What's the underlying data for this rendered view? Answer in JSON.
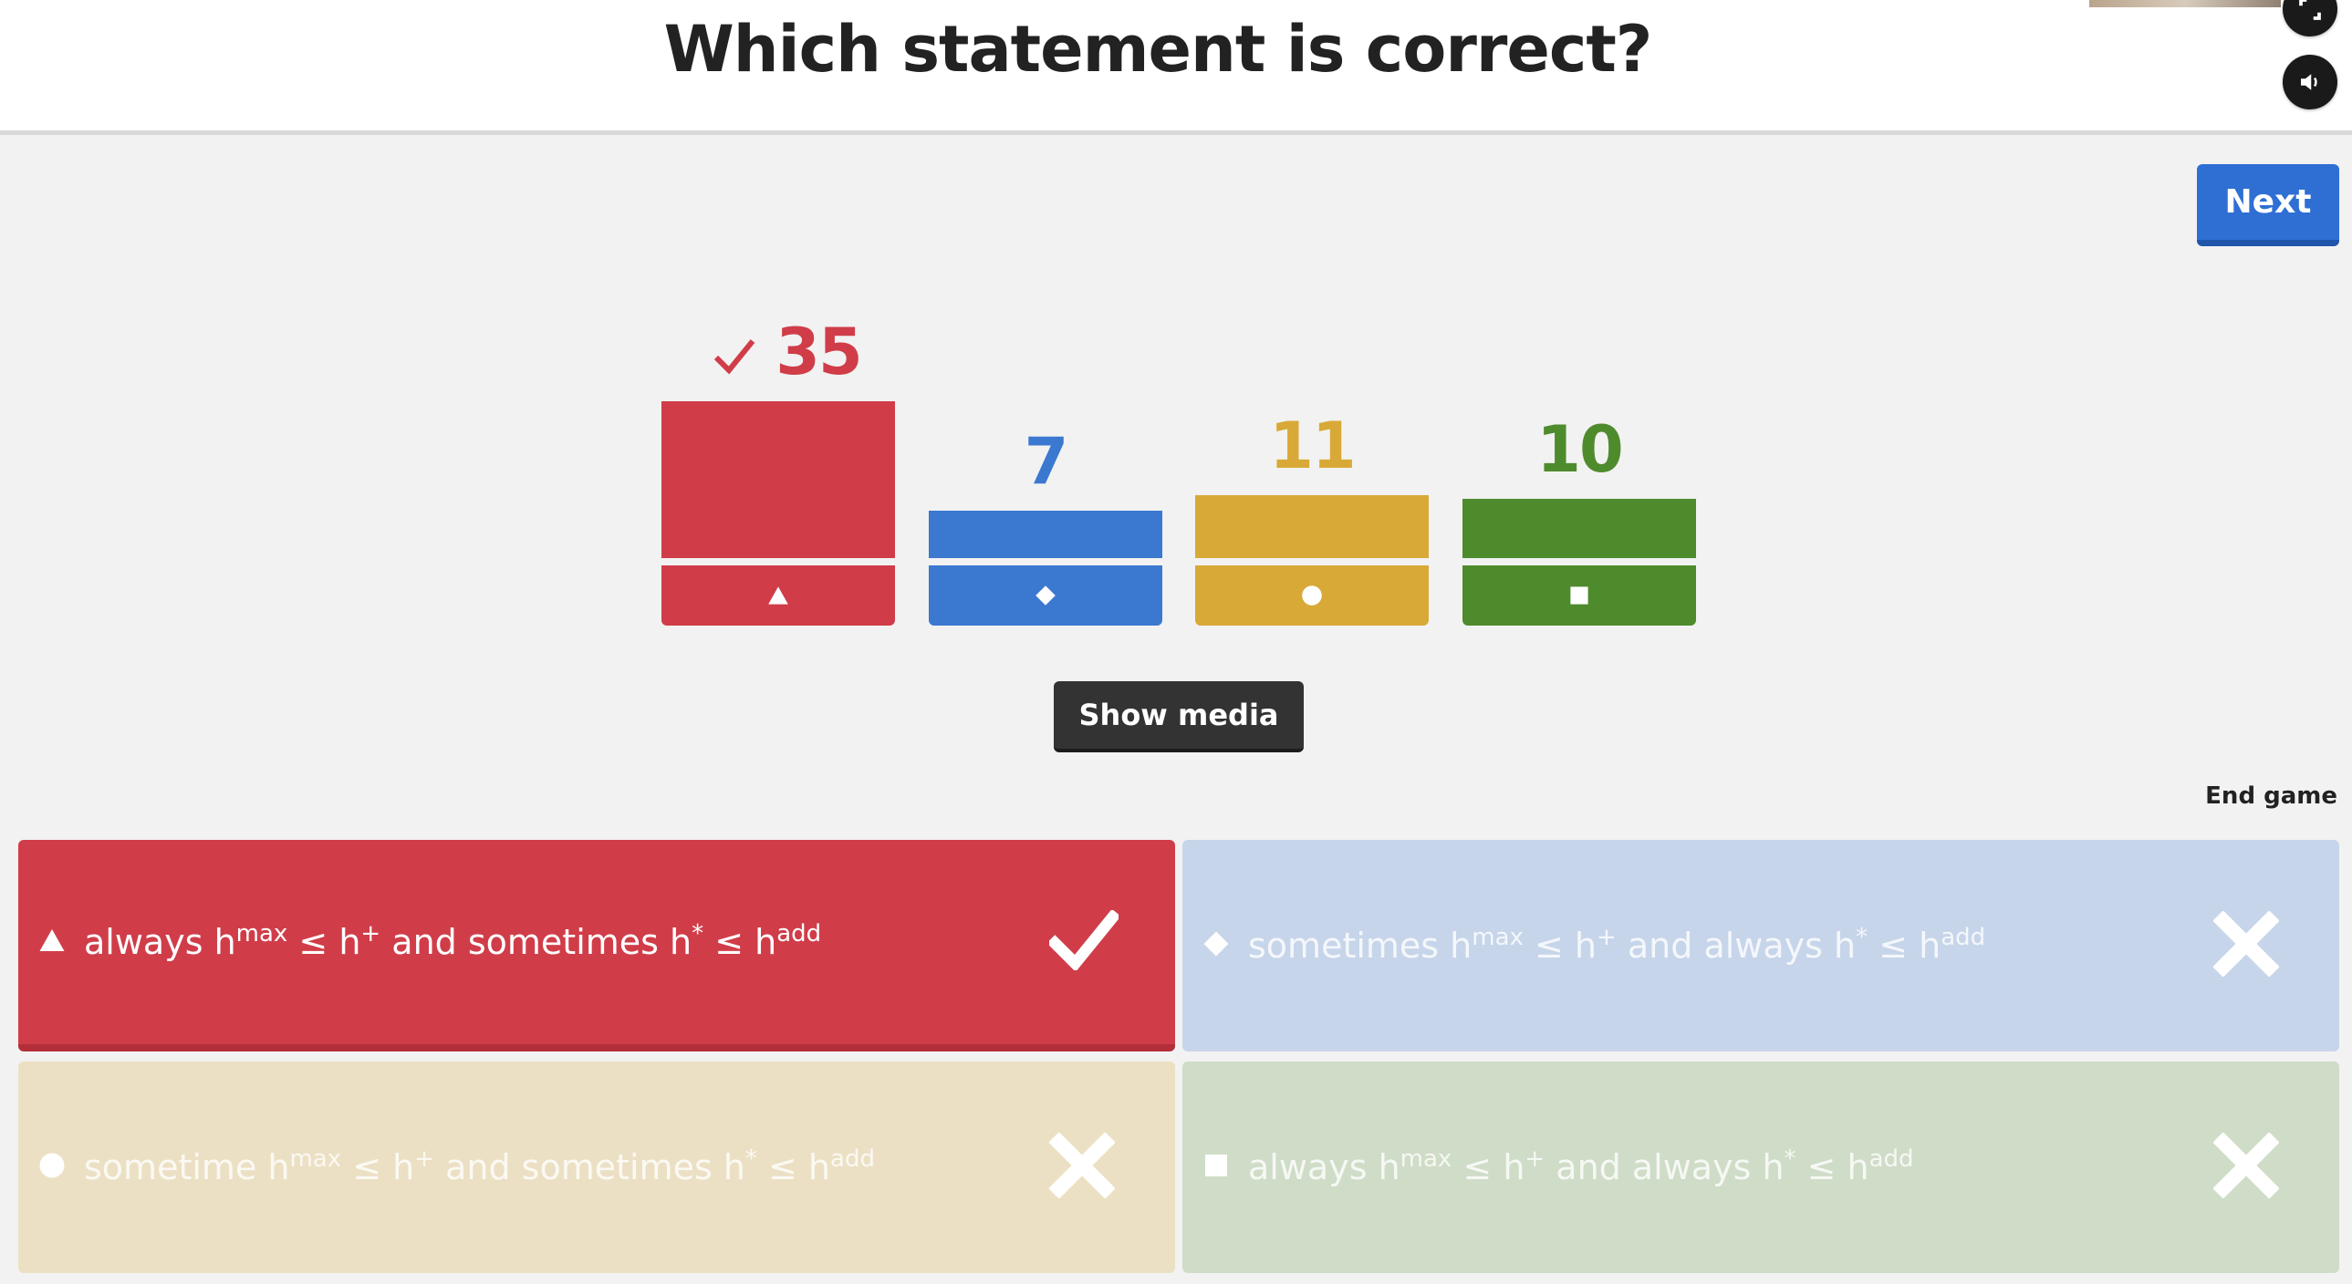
{
  "question": "Which statement is correct?",
  "controls": {
    "next_label": "Next",
    "show_media_label": "Show media",
    "end_game_label": "End game"
  },
  "colors": {
    "red": "#d03d49",
    "blue": "#3b78d0",
    "yellow": "#d8a937",
    "green": "#4e8b2d"
  },
  "chart_data": {
    "type": "bar",
    "categories": [
      "triangle",
      "diamond",
      "circle",
      "square"
    ],
    "values": [
      35,
      7,
      11,
      10
    ],
    "correct_index": 0,
    "ylim": [
      0,
      35
    ]
  },
  "answers": [
    {
      "shape": "triangle",
      "correct": true,
      "parts": [
        "always h",
        "max",
        " ≤ h",
        "+",
        " and sometimes h",
        "*",
        " ≤ h",
        "add"
      ]
    },
    {
      "shape": "diamond",
      "correct": false,
      "parts": [
        "sometimes h",
        "max",
        " ≤ h",
        "+",
        " and always h",
        "*",
        " ≤ h",
        "add"
      ]
    },
    {
      "shape": "circle",
      "correct": false,
      "parts": [
        "sometime h",
        "max",
        " ≤ h",
        "+",
        " and sometimes h",
        "*",
        " ≤ h",
        "add"
      ]
    },
    {
      "shape": "square",
      "correct": false,
      "parts": [
        "always h",
        "max",
        " ≤ h",
        "+",
        " and always h",
        "*",
        " ≤ h",
        "add"
      ]
    }
  ]
}
